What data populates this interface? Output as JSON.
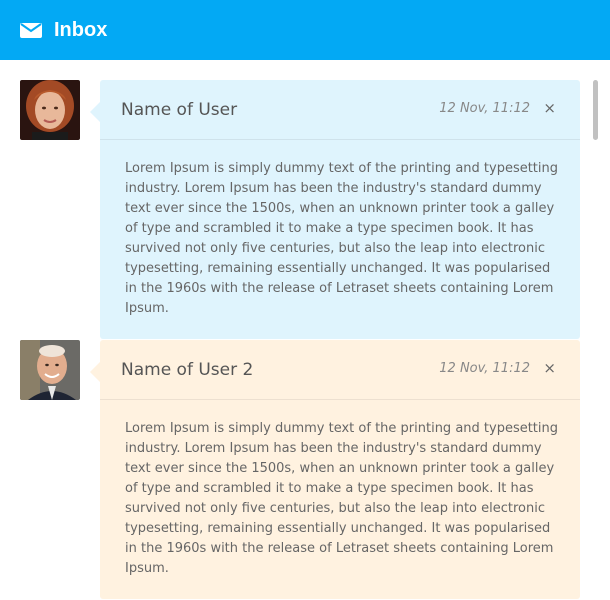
{
  "header": {
    "title": "Inbox",
    "icon": "envelope-icon",
    "color": "#03a9f4"
  },
  "messages": [
    {
      "name": "Name of User",
      "time": "12 Nov, 11:12",
      "close": "×",
      "text": "Lorem Ipsum is simply dummy text of the printing and typesetting industry. Lorem Ipsum has been the industry's standard dummy text ever since the 1500s, when an unknown printer took a galley of type and scrambled it to make a type specimen book. It has survived not only five centuries, but also the leap into electronic typesetting, remaining essentially unchanged. It was popularised in the 1960s with the release of Letraset sheets containing Lorem Ipsum.",
      "color": "#dff4fd"
    },
    {
      "name": "Name of User 2",
      "time": "12 Nov, 11:12",
      "close": "×",
      "text": "Lorem Ipsum is simply dummy text of the printing and typesetting industry. Lorem Ipsum has been the industry's standard dummy text ever since the 1500s, when an unknown printer took a galley of type and scrambled it to make a type specimen book. It has survived not only five centuries, but also the leap into electronic typesetting, remaining essentially unchanged. It was popularised in the 1960s with the release of Letraset sheets containing Lorem Ipsum.",
      "color": "#fff2e0"
    }
  ]
}
